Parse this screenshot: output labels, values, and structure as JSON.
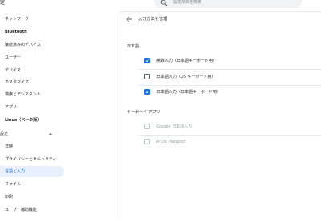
{
  "app": {
    "title": "定"
  },
  "search": {
    "placeholder": "設定項目を検索"
  },
  "sidebar": {
    "items": [
      {
        "label": "ネットワーク"
      },
      {
        "label": "Bluetooth"
      },
      {
        "label": "接続済みのデバイス"
      },
      {
        "label": "ユーザー"
      },
      {
        "label": "デバイス"
      },
      {
        "label": "カスタマイズ"
      },
      {
        "label": "検索とアシスタント"
      },
      {
        "label": "アプリ"
      },
      {
        "label": "Linux（ベータ版）"
      },
      {
        "label": "設定"
      },
      {
        "label": "日時"
      },
      {
        "label": "プライバシーとセキュリティ"
      },
      {
        "label": "言語と入力"
      },
      {
        "label": "ファイル"
      },
      {
        "label": "印刷"
      },
      {
        "label": "ユーザー補助機能"
      }
    ]
  },
  "main": {
    "title": "入力方法を管理",
    "sections": [
      {
        "label": "日本語",
        "items": [
          {
            "label": "英数入力（日本語キーボード用）",
            "state": "checked"
          },
          {
            "label": "日本語入力（US キーボード用）",
            "state": "unchecked"
          },
          {
            "label": "日本語入力（日本語キーボード用）",
            "state": "checked"
          }
        ]
      },
      {
        "label": "キーボード アプリ",
        "items": [
          {
            "label": "Google 日本語入力",
            "state": "disabled"
          },
          {
            "label": "ATOK Passport",
            "state": "disabled"
          }
        ]
      }
    ]
  },
  "colors": {
    "accent": "#1a73e8",
    "active_bg": "#e8f0fe",
    "active_text": "#1967d2"
  }
}
